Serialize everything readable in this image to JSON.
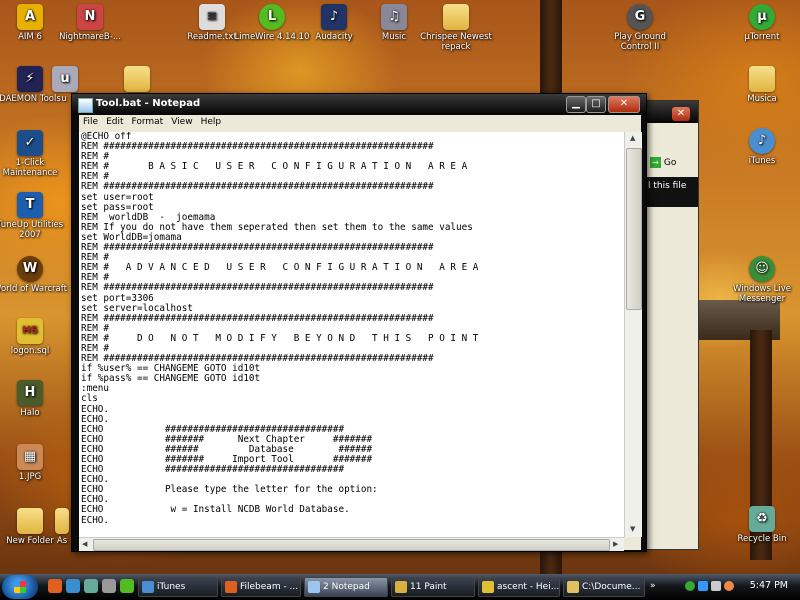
{
  "desktop": {
    "icons": [
      {
        "label": "AIM 6",
        "glyph": "A",
        "color": "#e8b000",
        "icon": "aim-icon"
      },
      {
        "label": "NightmareB-...",
        "glyph": "N",
        "color": "#c44",
        "icon": "nightmare-icon"
      },
      {
        "label": "Readme.txt",
        "glyph": "≡",
        "color": "#ddd",
        "icon": "text-file-icon"
      },
      {
        "label": "LimeWire 4.14.10",
        "glyph": "L",
        "color": "#5b2",
        "icon": "limewire-icon"
      },
      {
        "label": "Audacity",
        "glyph": "♪",
        "color": "#236",
        "icon": "audacity-icon"
      },
      {
        "label": "Music",
        "glyph": "♫",
        "color": "#889",
        "icon": "music-icon"
      },
      {
        "label": "Chrispee Newest repack",
        "glyph": "",
        "color": "",
        "icon": "folder-icon"
      },
      {
        "label": "Play Ground Control II",
        "glyph": "G",
        "color": "#555",
        "icon": "ground-control-icon"
      },
      {
        "label": "µTorrent",
        "glyph": "µ",
        "color": "#3a3",
        "icon": "utorrent-icon"
      },
      {
        "label": "DAEMON Tools",
        "glyph": "⚡",
        "color": "#225",
        "icon": "daemon-tools-icon"
      },
      {
        "label": "u",
        "glyph": "u",
        "color": "#aab",
        "icon": "shortcut-icon"
      },
      {
        "label": "",
        "glyph": "",
        "color": "",
        "icon": "folder-icon"
      },
      {
        "label": "Musica",
        "glyph": "",
        "color": "",
        "icon": "folder-icon"
      },
      {
        "label": "1-Click Maintenance",
        "glyph": "✓",
        "color": "#1d4e8a",
        "icon": "maintenance-icon"
      },
      {
        "label": "iTunes",
        "glyph": "♪",
        "color": "#4a8ed0",
        "icon": "itunes-icon"
      },
      {
        "label": "TuneUp Utilities 2007",
        "glyph": "T",
        "color": "#1d5fae",
        "icon": "tuneup-icon"
      },
      {
        "label": "World of Warcraft",
        "glyph": "W",
        "color": "#6b3d0a",
        "icon": "wow-icon"
      },
      {
        "label": "Windows Live Messenger",
        "glyph": "☺",
        "color": "#3a8e3a",
        "icon": "messenger-icon"
      },
      {
        "label": "logon.sql",
        "glyph": "HS",
        "color": "#e0c030",
        "icon": "sql-file-icon"
      },
      {
        "label": "Halo",
        "glyph": "H",
        "color": "#4b5a2a",
        "icon": "halo-icon"
      },
      {
        "label": "1.JPG",
        "glyph": "▦",
        "color": "#c85",
        "icon": "image-file-icon"
      },
      {
        "label": "New Folder",
        "glyph": "",
        "color": "",
        "icon": "folder-icon"
      },
      {
        "label": "As",
        "glyph": "",
        "color": "",
        "icon": "folder-icon"
      },
      {
        "label": "Recycle Bin",
        "glyph": "♻",
        "color": "#6a9",
        "icon": "recycle-bin-icon"
      }
    ],
    "bg_window": {
      "go_label": "Go",
      "text": "l this file"
    }
  },
  "notepad": {
    "title": "Tool.bat - Notepad",
    "menu": [
      "File",
      "Edit",
      "Format",
      "View",
      "Help"
    ],
    "lines": [
      "@ECHO off",
      "REM ###########################################################",
      "REM #",
      "REM #       B A S I C   U S E R   C O N F I G U R A T I O N   A R E A",
      "REM #",
      "REM ###########################################################",
      "set user=root",
      "set pass=root",
      "REM  worldDB  -  joemama",
      "REM If you do not have them seperated then set them to the same values",
      "set WorldDB=jomama",
      "REM ###########################################################",
      "REM #",
      "REM #   A D V A N C E D   U S E R   C O N F I G U R A T I O N   A R E A",
      "REM #",
      "REM ###########################################################",
      "set port=3306",
      "set server=localhost",
      "REM ###########################################################",
      "REM #",
      "REM #     D O   N O T   M O D I F Y   B E Y O N D   T H I S   P O I N T",
      "REM #",
      "REM ###########################################################",
      "if %user% == CHANGEME GOTO id10t",
      "if %pass% == CHANGEME GOTO id10t",
      ":menu",
      "cls",
      "ECHO.",
      "ECHO.",
      "ECHO           ################################",
      "ECHO           #######      Next Chapter     #######",
      "ECHO           ######         Database        ######",
      "ECHO           #######     Import Tool       #######",
      "ECHO           ################################",
      "ECHO.",
      "ECHO           Please type the letter for the option:",
      "ECHO.",
      "ECHO            w = Install NCDB World Database.",
      "ECHO."
    ]
  },
  "taskbar": {
    "buttons": [
      {
        "label": "iTunes",
        "color": "#4a8ed0",
        "active": false
      },
      {
        "label": "Filebeam - ...",
        "color": "#e06020",
        "active": false
      },
      {
        "label": "2 Notepad",
        "color": "#9cc6ee",
        "active": true
      },
      {
        "label": "11 Paint",
        "color": "#d9b040",
        "active": false
      },
      {
        "label": "ascent - Hei...",
        "color": "#e0c030",
        "active": false
      },
      {
        "label": "C:\\Docume...",
        "color": "#e0c060",
        "active": false
      }
    ],
    "clock": "5:47 PM"
  }
}
